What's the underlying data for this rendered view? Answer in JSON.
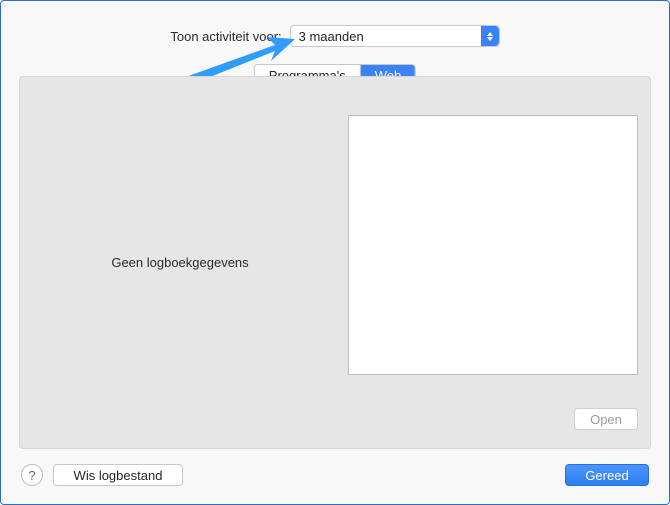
{
  "header": {
    "label": "Toon activiteit voor:",
    "dropdown_value": "3 maanden"
  },
  "tabs": {
    "programmas": "Programma's",
    "web": "Web",
    "active": "web"
  },
  "panel": {
    "no_log_message": "Geen logboekgegevens",
    "open_label": "Open"
  },
  "footer": {
    "help_symbol": "?",
    "clear_log_label": "Wis logbestand",
    "done_label": "Gereed"
  }
}
